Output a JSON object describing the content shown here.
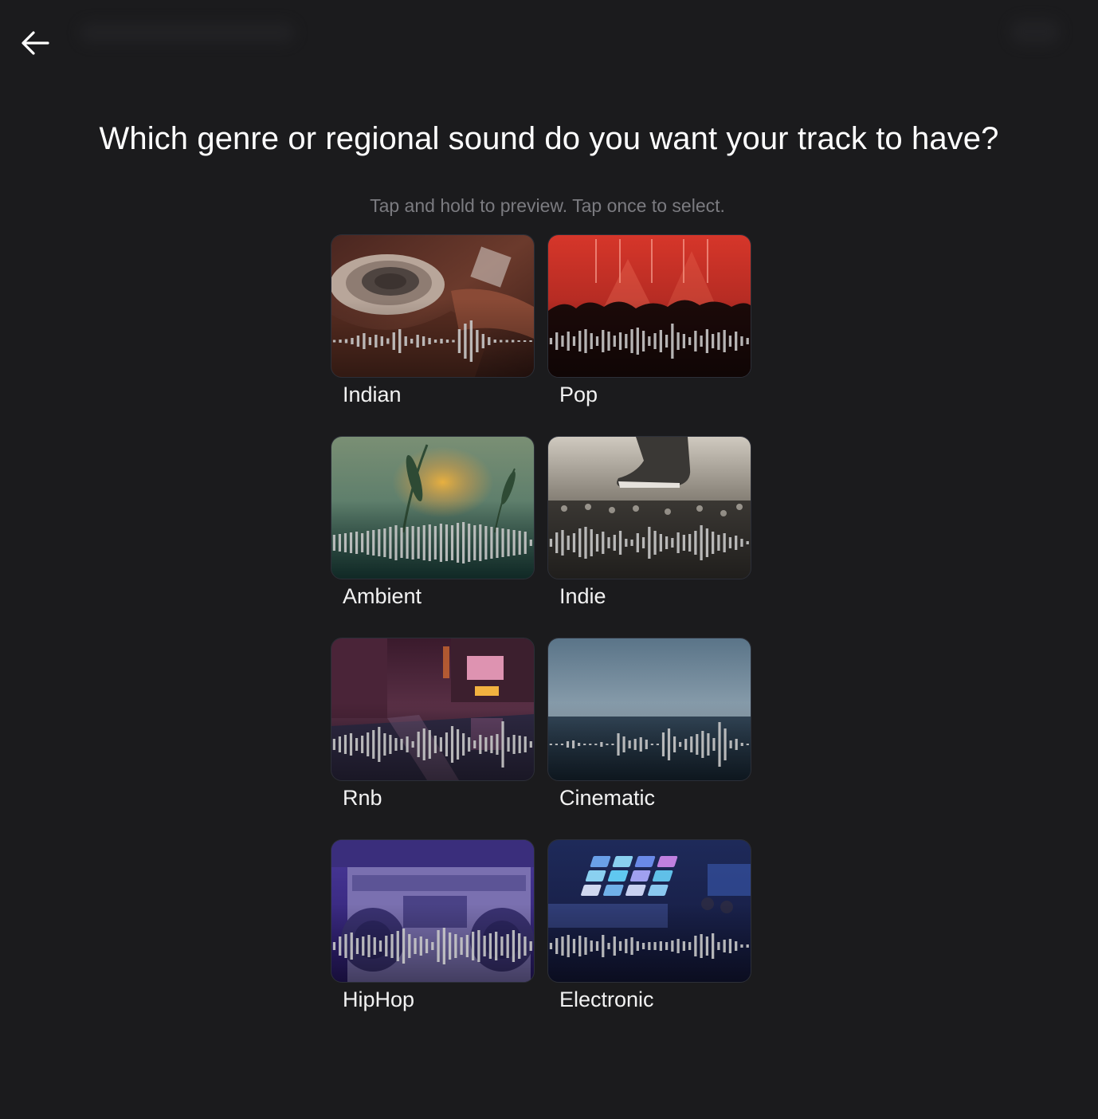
{
  "header": {
    "back_icon": "arrow-left-icon",
    "title": "Which genre or regional sound do you want your track to have?",
    "subtitle": "Tap and hold to preview. Tap once to select."
  },
  "genres": [
    {
      "label": "Indian",
      "image": "tabla-drum-photo"
    },
    {
      "label": "Pop",
      "image": "concert-crowd-red-lights-photo"
    },
    {
      "label": "Ambient",
      "image": "sunset-grass-photo"
    },
    {
      "label": "Indie",
      "image": "sneaker-on-mixer-photo"
    },
    {
      "label": "Rnb",
      "image": "rainy-city-night-photo"
    },
    {
      "label": "Cinematic",
      "image": "ocean-horizon-photo"
    },
    {
      "label": "HipHop",
      "image": "boombox-photo"
    },
    {
      "label": "Electronic",
      "image": "drum-pad-controller-photo"
    }
  ],
  "colors": {
    "background": "#1b1b1d",
    "title": "#ffffff",
    "subtitle": "#7b7b80",
    "waveform": "#c8c8c8"
  }
}
